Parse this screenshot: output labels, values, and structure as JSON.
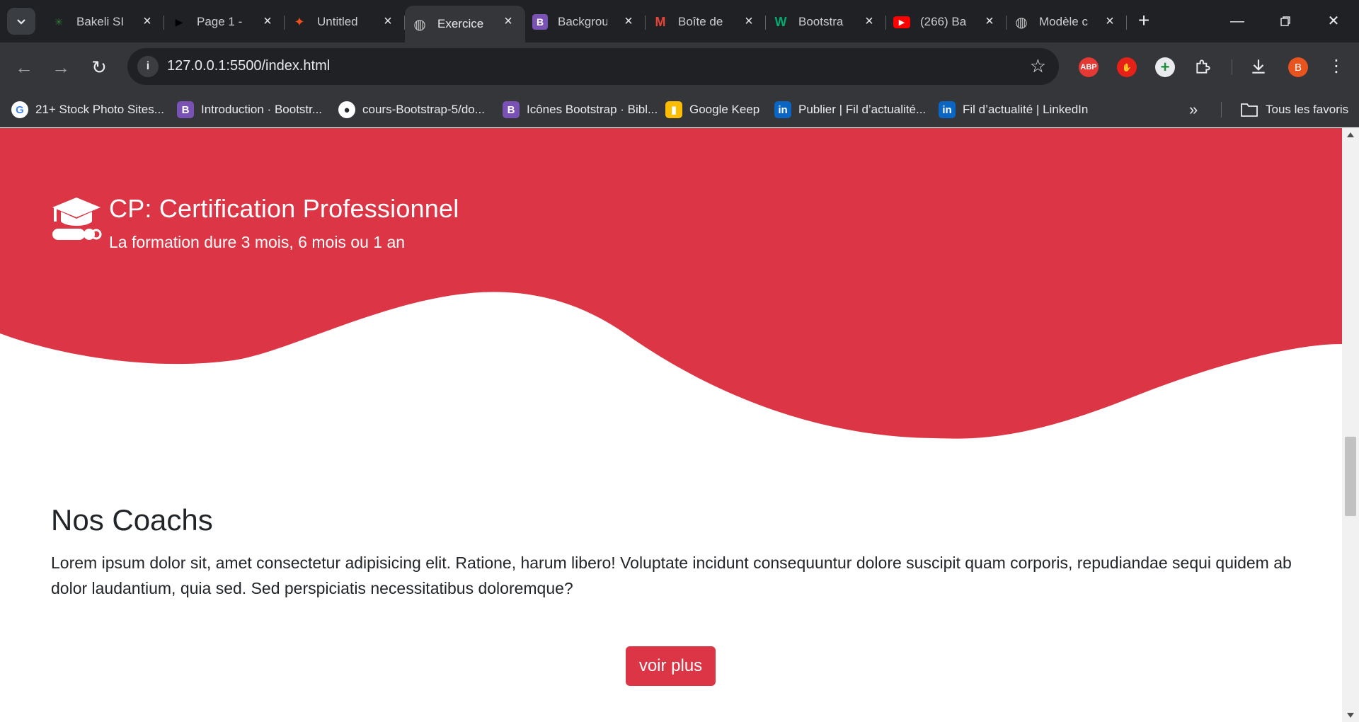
{
  "browser": {
    "tabs": [
      {
        "title": "Bakeli SI",
        "icon": "bakeli-logo-icon",
        "color": "#2e7d32"
      },
      {
        "title": "Page 1 -",
        "icon": "play-icon",
        "color": "#000000"
      },
      {
        "title": "Untitled",
        "icon": "figma-icon",
        "color": "#f24e1e"
      },
      {
        "title": "Exercice",
        "icon": "globe-icon",
        "color": "#9aa0a6",
        "active": true
      },
      {
        "title": "Backgrou",
        "icon": "bootstrap-icon",
        "color": "#7952b3"
      },
      {
        "title": "Boîte de",
        "icon": "gmail-icon",
        "color": "#ea4335"
      },
      {
        "title": "Bootstra",
        "icon": "w-icon",
        "color": "#04aa6d"
      },
      {
        "title": "(266) Ba",
        "icon": "youtube-icon",
        "color": "#ff0000"
      },
      {
        "title": "Modèle c",
        "icon": "globe-icon",
        "color": "#9aa0a6"
      }
    ],
    "url": "127.0.0.1:5500/index.html",
    "profile_initial": "B",
    "extensions": {
      "abp": "ABP"
    },
    "bookmarks": [
      {
        "label": "21+ Stock Photo Sites...",
        "icon": "google-icon",
        "color": "#ffffff",
        "glyph": "G"
      },
      {
        "label": "Introduction · Bootstr...",
        "icon": "bootstrap-icon",
        "color": "#7952b3",
        "glyph": "B"
      },
      {
        "label": "cours-Bootstrap-5/do...",
        "icon": "github-icon",
        "color": "#ffffff",
        "glyph": "●"
      },
      {
        "label": "Icônes Bootstrap · Bibl...",
        "icon": "bootstrap-icon",
        "color": "#7952b3",
        "glyph": "B"
      },
      {
        "label": "Google Keep",
        "icon": "keep-icon",
        "color": "#fbbc04",
        "glyph": "▮"
      },
      {
        "label": "Publier | Fil d’actualité...",
        "icon": "linkedin-icon",
        "color": "#0a66c2",
        "glyph": "in"
      },
      {
        "label": "Fil d’actualité | LinkedIn",
        "icon": "linkedin-icon",
        "color": "#0a66c2",
        "glyph": "in"
      }
    ],
    "all_bookmarks": "Tous les favoris"
  },
  "hero": {
    "title": "CP: Certification Professionnel",
    "subtitle": "La formation dure 3 mois, 6 mois ou 1 an",
    "color": "#dc3545",
    "icon": "graduation-cap-icon"
  },
  "coachs": {
    "title": "Nos Coachs",
    "text": "Lorem ipsum dolor sit, amet consectetur adipisicing elit. Ratione, harum libero! Voluptate incidunt consequuntur dolore suscipit quam corporis, repudiandae sequi quidem ab dolor laudantium, quia sed. Sed perspiciatis necessitatibus doloremque?",
    "button": "voir plus"
  }
}
